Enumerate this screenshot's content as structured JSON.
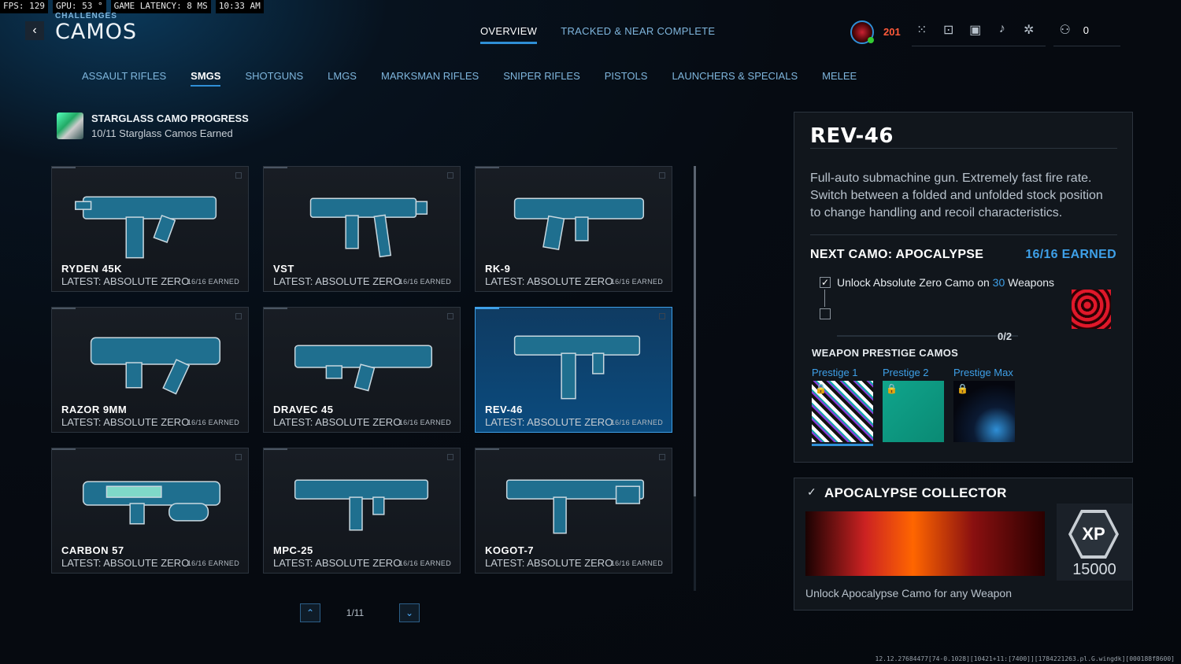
{
  "perf": {
    "fps": "FPS: 129",
    "gpu": "GPU: 53 °",
    "latency": "GAME LATENCY:  8 MS",
    "time": "10:33 AM"
  },
  "header": {
    "supertitle": "CHALLENGES",
    "title": "CAMOS",
    "back_icon": "chevron-left-icon"
  },
  "top_tabs": [
    {
      "label": "OVERVIEW",
      "active": true
    },
    {
      "label": "TRACKED & NEAR COMPLETE",
      "active": false
    }
  ],
  "top_right": {
    "level": "201",
    "friends_count": "0",
    "icons": [
      "grid-icon",
      "lock-icon",
      "camera-icon",
      "bell-icon",
      "gear-icon"
    ]
  },
  "category_tabs": [
    {
      "label": "ASSAULT RIFLES",
      "active": false
    },
    {
      "label": "SMGS",
      "active": true
    },
    {
      "label": "SHOTGUNS",
      "active": false
    },
    {
      "label": "LMGS",
      "active": false
    },
    {
      "label": "MARKSMAN RIFLES",
      "active": false
    },
    {
      "label": "SNIPER RIFLES",
      "active": false
    },
    {
      "label": "PISTOLS",
      "active": false
    },
    {
      "label": "LAUNCHERS & SPECIALS",
      "active": false
    },
    {
      "label": "MELEE",
      "active": false
    }
  ],
  "progress": {
    "title": "STARGLASS CAMO PROGRESS",
    "subtitle": "10/11 Starglass Camos Earned"
  },
  "weapons": [
    {
      "name": "RYDEN 45K",
      "latest": "LATEST: ABSOLUTE ZERO",
      "earned": "16/16 EARNED",
      "selected": false
    },
    {
      "name": "VST",
      "latest": "LATEST: ABSOLUTE ZERO",
      "earned": "16/16 EARNED",
      "selected": false
    },
    {
      "name": "RK-9",
      "latest": "LATEST: ABSOLUTE ZERO",
      "earned": "16/16 EARNED",
      "selected": false
    },
    {
      "name": "RAZOR 9MM",
      "latest": "LATEST: ABSOLUTE ZERO",
      "earned": "16/16 EARNED",
      "selected": false
    },
    {
      "name": "DRAVEC 45",
      "latest": "LATEST: ABSOLUTE ZERO",
      "earned": "16/16 EARNED",
      "selected": false
    },
    {
      "name": "REV-46",
      "latest": "LATEST: ABSOLUTE ZERO",
      "earned": "16/16 EARNED",
      "selected": true
    },
    {
      "name": "CARBON 57",
      "latest": "LATEST: ABSOLUTE ZERO",
      "earned": "16/16 EARNED",
      "selected": false
    },
    {
      "name": "MPC-25",
      "latest": "LATEST: ABSOLUTE ZERO",
      "earned": "16/16 EARNED",
      "selected": false
    },
    {
      "name": "KOGOT-7",
      "latest": "LATEST: ABSOLUTE ZERO",
      "earned": "16/16 EARNED",
      "selected": false
    }
  ],
  "pager": {
    "page": "1/11"
  },
  "detail": {
    "title": "REV-46",
    "description": "Full-auto submachine gun. Extremely fast fire rate. Switch between a folded and unfolded stock position to change handling and recoil characteristics.",
    "next_camo": "NEXT CAMO: APOCALYPSE",
    "next_earned": "16/16 EARNED",
    "challenge_prefix": "Unlock Absolute Zero Camo on ",
    "challenge_count": "30",
    "challenge_suffix": " Weapons",
    "challenge_progress": "0/2",
    "prestige_title": "WEAPON PRESTIGE CAMOS",
    "prestige": [
      {
        "label": "Prestige 1"
      },
      {
        "label": "Prestige 2"
      },
      {
        "label": "Prestige Max"
      }
    ]
  },
  "reward": {
    "title": "APOCALYPSE COLLECTOR",
    "xp_label": "XP",
    "xp_value": "15000",
    "description": "Unlock Apocalypse Camo for any Weapon"
  },
  "build_string": "12.12.27684477[74-0.1028][10421+11:[7400]][1784221263.pl.G.wingdk][000188f8600]",
  "colors": {
    "accent": "#3ea0e8",
    "level": "#ff5a3a",
    "background": "#05080d"
  }
}
